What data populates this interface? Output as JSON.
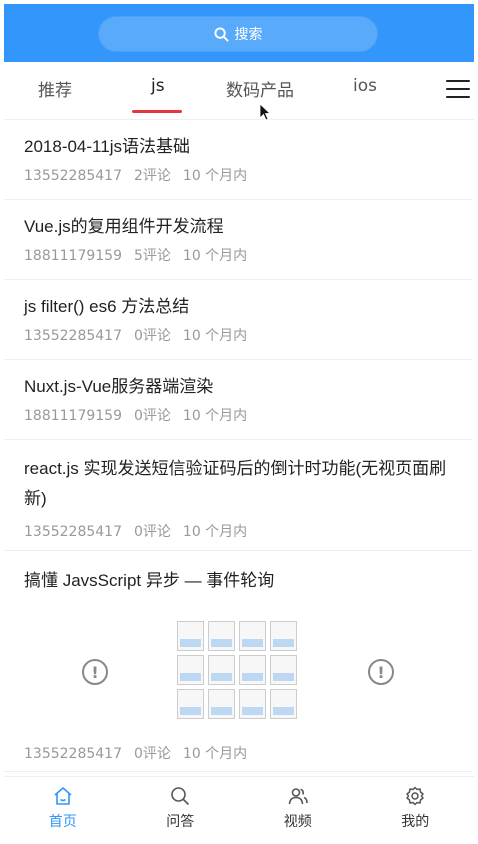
{
  "search": {
    "label": "搜索"
  },
  "tabs": [
    {
      "label": "推荐"
    },
    {
      "label": "js"
    },
    {
      "label": "数码产品"
    },
    {
      "label": "ios"
    }
  ],
  "articles": [
    {
      "title": "2018-04-11js语法基础",
      "author": "13552285417",
      "comments": "2评论",
      "time": "10 个月内"
    },
    {
      "title": "Vue.js的复用组件开发流程",
      "author": "18811179159",
      "comments": "5评论",
      "time": "10 个月内"
    },
    {
      "title": "js filter() es6 方法总结",
      "author": "13552285417",
      "comments": "0评论",
      "time": "10 个月内"
    },
    {
      "title": "Nuxt.js-Vue服务器端渲染",
      "author": "18811179159",
      "comments": "0评论",
      "time": "10 个月内"
    },
    {
      "title": "react.js 实现发送短信验证码后的倒计时功能(无视页面刷新)",
      "author": "13552285417",
      "comments": "0评论",
      "time": "10 个月内"
    },
    {
      "title": "搞懂 JavsScript 异步 — 事件轮询",
      "author": "13552285417",
      "comments": "0评论",
      "time": "10 个月内"
    }
  ],
  "bottom_nav": [
    {
      "label": "首页",
      "icon": "home-icon"
    },
    {
      "label": "问答",
      "icon": "search-icon"
    },
    {
      "label": "视频",
      "icon": "users-icon"
    },
    {
      "label": "我的",
      "icon": "gear-icon"
    }
  ],
  "colors": {
    "primary": "#3296fa",
    "tab_indicator": "#e4393c",
    "meta_text": "#999999"
  }
}
